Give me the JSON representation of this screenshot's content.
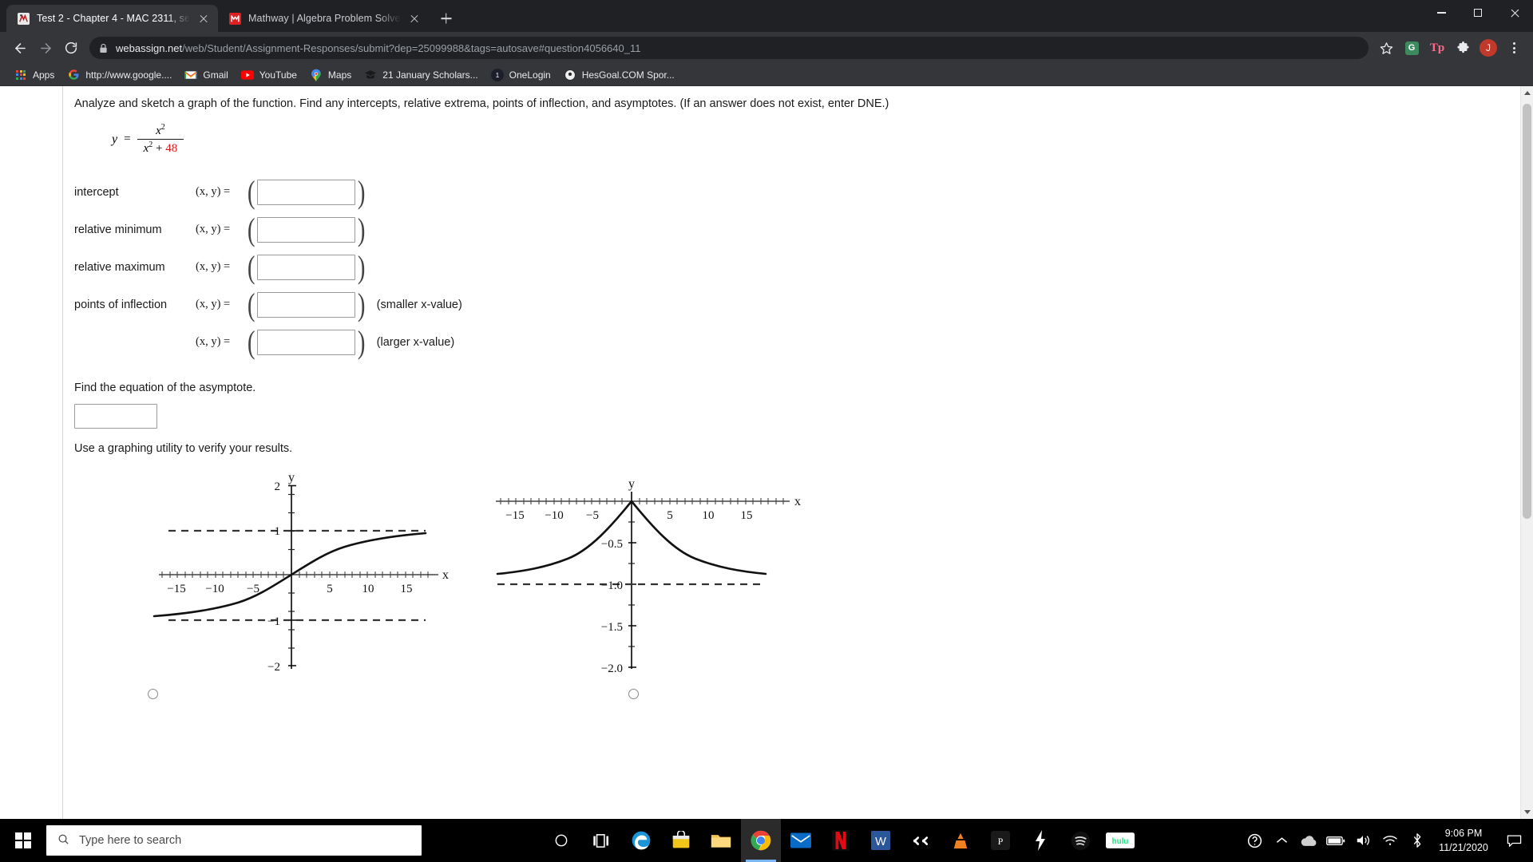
{
  "browser": {
    "tabs": [
      {
        "title": "Test 2 - Chapter 4 - MAC 2311, se",
        "favicon": "webassign-icon",
        "active": true
      },
      {
        "title": "Mathway | Algebra Problem Solve",
        "favicon": "mathway-icon",
        "active": false
      }
    ],
    "newtab_label": "+",
    "window_controls": {
      "minimize": "minimize-icon",
      "maximize": "maximize-icon",
      "close": "close-icon"
    },
    "nav": {
      "back": "back-arrow-icon",
      "forward": "forward-arrow-icon",
      "reload": "reload-icon"
    },
    "omnibox": {
      "lock": "lock-icon",
      "domain": "webassign.net",
      "path": "/web/Student/Assignment-Responses/submit?dep=25099988&tags=autosave#question4056640_11",
      "star": "bookmark-star-icon",
      "ext1": "G",
      "ext2": "Tp",
      "ext3": "puzzle-extension-icon",
      "profile": "J",
      "menu": "kebab-menu-icon"
    },
    "bookmarks": [
      {
        "label": "Apps",
        "icon": "apps-grid-icon"
      },
      {
        "label": "http://www.google....",
        "icon": "google-icon"
      },
      {
        "label": "Gmail",
        "icon": "gmail-icon"
      },
      {
        "label": "YouTube",
        "icon": "youtube-icon"
      },
      {
        "label": "Maps",
        "icon": "maps-icon"
      },
      {
        "label": "21 January Scholars...",
        "icon": "graduation-cap-icon"
      },
      {
        "label": "OneLogin",
        "icon": "onelogin-icon"
      },
      {
        "label": "HesGoal.COM Spor...",
        "icon": "soccer-ball-icon"
      }
    ]
  },
  "question": {
    "prompt": "Analyze and sketch a graph of the function. Find any intercepts, relative extrema, points of inflection, and asymptotes. (If an answer does not exist, enter DNE.)",
    "equation": {
      "lhs": "y",
      "equals": "=",
      "numerator_var": "x",
      "numerator_exp": "2",
      "denominator_var": "x",
      "denominator_exp": "2",
      "denominator_plus": "+",
      "denominator_const": "48"
    },
    "rows": [
      {
        "label": "intercept",
        "xy": "(x, y) =",
        "value": "",
        "suffix": ""
      },
      {
        "label": "relative minimum",
        "xy": "(x, y) =",
        "value": "",
        "suffix": ""
      },
      {
        "label": "relative maximum",
        "xy": "(x, y) =",
        "value": "",
        "suffix": ""
      },
      {
        "label": "points of inflection",
        "xy": "(x, y) =",
        "value": "",
        "suffix": "(smaller x-value)"
      },
      {
        "label": "",
        "xy": "(x, y) =",
        "value": "",
        "suffix": "(larger x-value)"
      }
    ],
    "asymptote_prompt": "Find the equation of the asymptote.",
    "asymptote_value": "",
    "verify_text": "Use a graphing utility to verify your results."
  },
  "chart_data": [
    {
      "type": "line",
      "title": "",
      "xlabel": "x",
      "ylabel": "y",
      "xlim": [
        -18,
        18
      ],
      "ylim": [
        -2.15,
        2.15
      ],
      "xticks": [
        -15,
        -10,
        -5,
        5,
        10,
        15
      ],
      "yticks": [
        2,
        1,
        -1,
        -2
      ],
      "xtick_labels": [
        "−15",
        "−10",
        "−5",
        "5",
        "10",
        "15"
      ],
      "ytick_labels": [
        "2",
        "1",
        "−1",
        "−2"
      ],
      "minor_tick_step": 1,
      "grid": false,
      "asymptotes": [
        {
          "type": "horizontal",
          "y": 1,
          "style": "dashed"
        },
        {
          "type": "horizontal",
          "y": -1,
          "style": "dashed"
        }
      ],
      "series": [
        {
          "name": "curve-a",
          "description": "odd sigmoid rising from -1 to 1 through origin",
          "x": [
            -18,
            -16,
            -14,
            -12,
            -10,
            -8,
            -6,
            -4,
            -2,
            0,
            2,
            4,
            6,
            8,
            10,
            12,
            14,
            16,
            18
          ],
          "y": [
            -0.93,
            -0.92,
            -0.9,
            -0.87,
            -0.82,
            -0.76,
            -0.65,
            -0.5,
            -0.28,
            0,
            0.28,
            0.5,
            0.65,
            0.76,
            0.82,
            0.87,
            0.9,
            0.92,
            0.93
          ]
        }
      ],
      "selected": false
    },
    {
      "type": "line",
      "title": "",
      "xlabel": "x",
      "ylabel": "y",
      "xlim": [
        -18,
        18
      ],
      "ylim": [
        -2.15,
        0.22
      ],
      "xticks": [
        -15,
        -10,
        -5,
        5,
        10,
        15
      ],
      "yticks": [
        -0.5,
        -1.0,
        -1.5,
        -2.0
      ],
      "xtick_labels": [
        "−15",
        "−10",
        "−5",
        "5",
        "10",
        "15"
      ],
      "ytick_labels": [
        "−0.5",
        "−1.0",
        "−1.5",
        "−2.0"
      ],
      "minor_tick_step": 1,
      "grid": false,
      "asymptotes": [
        {
          "type": "horizontal",
          "y": -1.0,
          "style": "dashed"
        }
      ],
      "series": [
        {
          "name": "curve-b",
          "description": "inverted bell peaking at origin, decaying toward -1",
          "x": [
            -18,
            -16,
            -14,
            -12,
            -10,
            -8,
            -6,
            -4,
            -2,
            0,
            2,
            4,
            6,
            8,
            10,
            12,
            14,
            16,
            18
          ],
          "y": [
            -0.87,
            -0.84,
            -0.8,
            -0.75,
            -0.68,
            -0.57,
            -0.43,
            -0.25,
            -0.08,
            0,
            -0.08,
            -0.25,
            -0.43,
            -0.57,
            -0.68,
            -0.75,
            -0.8,
            -0.84,
            -0.87
          ]
        }
      ],
      "selected": false
    }
  ],
  "taskbar": {
    "start": "windows-start-icon",
    "search_placeholder": "Type here to search",
    "search_icon": "search-icon",
    "cortana": "cortana-icon",
    "taskview": "task-view-icon",
    "pinned": [
      {
        "name": "edge-icon"
      },
      {
        "name": "store-icon"
      },
      {
        "name": "file-explorer-icon"
      },
      {
        "name": "chrome-icon",
        "active": true
      },
      {
        "name": "mail-icon"
      },
      {
        "name": "netflix-icon"
      },
      {
        "name": "word-icon"
      },
      {
        "name": "slack-icon"
      },
      {
        "name": "vlc-icon"
      },
      {
        "name": "teamviewer-icon"
      },
      {
        "name": "lightning-icon"
      },
      {
        "name": "spotify-icon"
      },
      {
        "name": "hulu-icon"
      }
    ],
    "tray": [
      {
        "name": "help-icon"
      },
      {
        "name": "chevron-up-icon"
      },
      {
        "name": "onedrive-icon"
      },
      {
        "name": "battery-icon"
      },
      {
        "name": "volume-icon"
      },
      {
        "name": "wifi-icon"
      },
      {
        "name": "bluetooth-icon"
      }
    ],
    "time": "9:06 PM",
    "date": "11/21/2020",
    "action_center": "action-center-icon"
  },
  "colors": {
    "chrome_dark": "#202124",
    "chrome_toolbar": "#35363a",
    "accent_red": "#e01b1b",
    "taskbar_black": "#000000",
    "active_tab_underline": "#7ab6f2"
  }
}
